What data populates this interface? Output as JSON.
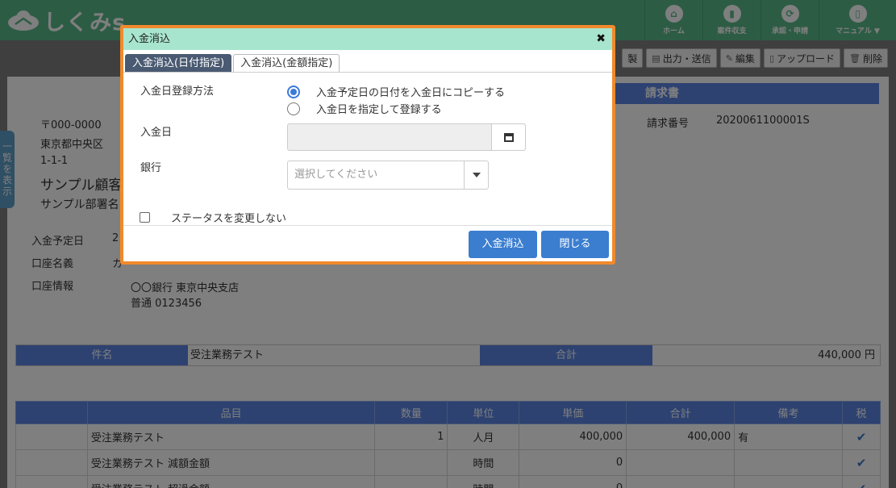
{
  "app": {
    "logo_text": "しくみs"
  },
  "nav": [
    {
      "label": "ホーム",
      "icon": "home-icon"
    },
    {
      "label": "案件収支",
      "icon": "chart-icon"
    },
    {
      "label": "承認・申請",
      "icon": "refresh-icon"
    },
    {
      "label": "マニュアル ▼",
      "icon": "book-icon"
    }
  ],
  "toolbar": {
    "duplicate": "製",
    "output": "出力・送信",
    "edit": "編集",
    "upload": "アップロード",
    "delete": "削除"
  },
  "side_tab": "一覧を表示",
  "invoice": {
    "title": "請求書",
    "number_label": "請求番号",
    "number_value": "2020061100001S"
  },
  "address": {
    "postal": "〒000-0000",
    "line1": "東京都中央区",
    "line2": "1-1-1",
    "customer": "サンプル顧客",
    "dept": "サンプル部署名"
  },
  "payment": {
    "due_label": "入金予定日",
    "due_value": "2",
    "account_name_label": "口座名義",
    "account_name_value": "カ",
    "account_info_label": "口座情報",
    "bank_line1": "〇〇銀行 東京中央支店",
    "bank_line2": "普通 0123456"
  },
  "summary": {
    "subject_label": "件名",
    "subject_value": "受注業務テスト",
    "total_label": "合計",
    "total_value": "440,000 円"
  },
  "items": {
    "headers": [
      "",
      "品目",
      "数量",
      "単位",
      "単価",
      "合計",
      "備考",
      "税"
    ],
    "rows": [
      {
        "name": "受注業務テスト",
        "qty": "1",
        "unit": "人月",
        "price": "400,000",
        "total": "400,000",
        "note": "有"
      },
      {
        "name": "受注業務テスト 減額金額",
        "qty": "",
        "unit": "時間",
        "price": "0",
        "total": "",
        "note": ""
      },
      {
        "name": "受注業務テスト 超過金額",
        "qty": "",
        "unit": "時間",
        "price": "0",
        "total": "",
        "note": ""
      }
    ]
  },
  "modal": {
    "title": "入金消込",
    "close": "✖",
    "tabs": [
      "入金消込(日付指定)",
      "入金消込(金額指定)"
    ],
    "method_label": "入金日登録方法",
    "radio1": "入金予定日の日付を入金日にコピーする",
    "radio2": "入金日を指定して登録する",
    "date_label": "入金日",
    "bank_label": "銀行",
    "bank_placeholder": "選択してください",
    "status_checkbox": "ステータスを変更しない",
    "ok_button": "入金消込",
    "close_button": "閉じる"
  }
}
